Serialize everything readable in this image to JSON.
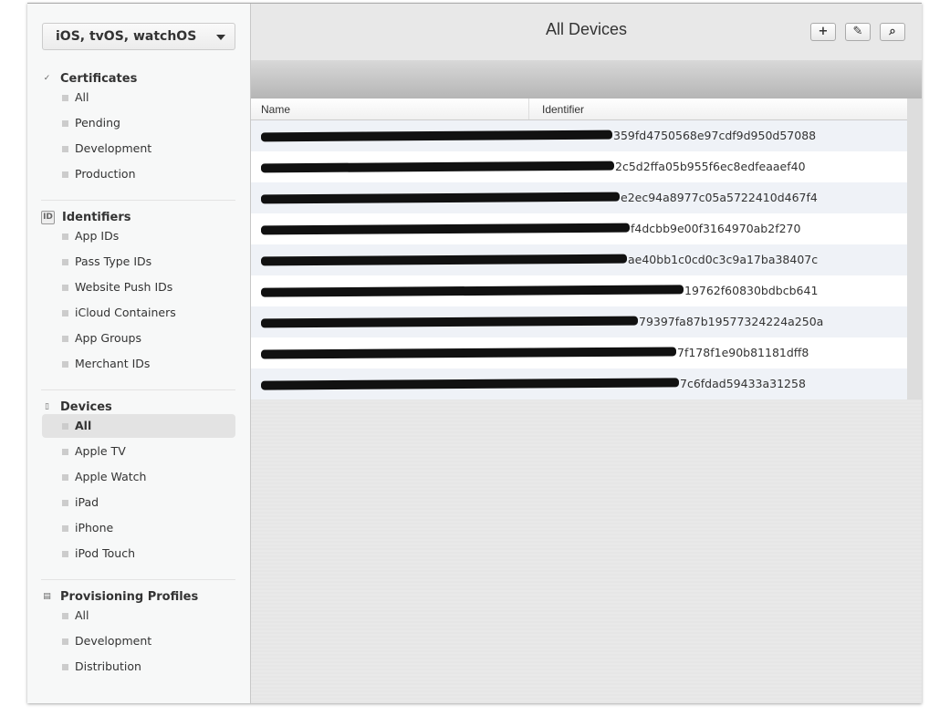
{
  "sidebar": {
    "platform": "iOS, tvOS, watchOS",
    "sections": [
      {
        "title": "Certificates",
        "icon": "certificate-icon",
        "items": [
          "All",
          "Pending",
          "Development",
          "Production"
        ]
      },
      {
        "title": "Identifiers",
        "icon": "id-icon",
        "items": [
          "App IDs",
          "Pass Type IDs",
          "Website Push IDs",
          "iCloud Containers",
          "App Groups",
          "Merchant IDs"
        ]
      },
      {
        "title": "Devices",
        "icon": "device-icon",
        "items": [
          "All",
          "Apple TV",
          "Apple Watch",
          "iPad",
          "iPhone",
          "iPod Touch"
        ],
        "selected": "All"
      },
      {
        "title": "Provisioning Profiles",
        "icon": "document-icon",
        "items": [
          "All",
          "Development",
          "Distribution"
        ]
      }
    ]
  },
  "header": {
    "title": "All Devices",
    "buttons": {
      "add": "+",
      "edit": "✎",
      "search": "⌕"
    }
  },
  "table": {
    "columns": [
      "Name",
      "Identifier"
    ],
    "rows": [
      {
        "name": "[redacted]",
        "identifier": "359fd4750568e97cdf9d950d57088"
      },
      {
        "name": "[redacted]",
        "identifier": "2c5d2ffa05b955f6ec8edfeaaef40"
      },
      {
        "name": "[redacted]",
        "identifier": "e2ec94a8977c05a5722410d467f4"
      },
      {
        "name": "[redacted]",
        "identifier": "f4dcbb9e00f3164970ab2f270"
      },
      {
        "name": "[redacted]",
        "identifier": "ae40bb1c0cd0c3c9a17ba38407c"
      },
      {
        "name": "[redacted]",
        "identifier": "19762f60830bdbcb641"
      },
      {
        "name": "[redacted]",
        "identifier": "79397fa87b19577324224a250a"
      },
      {
        "name": "[redacted]",
        "identifier": "7f178f1e90b81181dff8"
      },
      {
        "name": "[redacted]",
        "identifier": "7c6fdad59433a31258"
      }
    ]
  }
}
